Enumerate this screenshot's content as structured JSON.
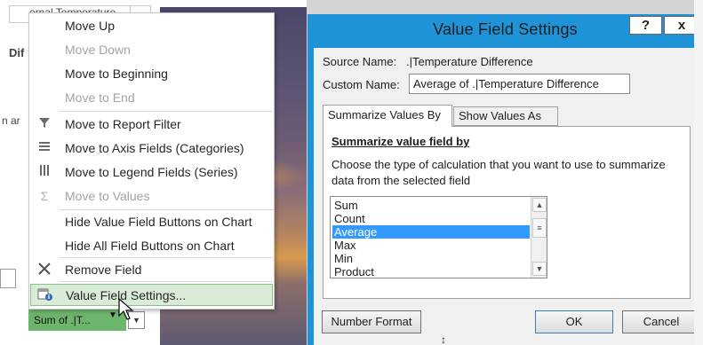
{
  "background": {
    "top_field_text": "ernal Temperature",
    "dif_text": "Dif",
    "n_ar_text": "n ar",
    "field_button_label": "Sum of .|T...",
    "field_button_color": "#6db56d"
  },
  "context_menu": {
    "items": [
      {
        "label": "Move Up",
        "icon": "",
        "disabled": false
      },
      {
        "label": "Move Down",
        "icon": "",
        "disabled": true
      },
      {
        "label": "Move to Beginning",
        "icon": "",
        "disabled": false
      },
      {
        "label": "Move to End",
        "icon": "",
        "disabled": true
      },
      {
        "label": "Move to Report Filter",
        "icon": "filter-icon",
        "disabled": false
      },
      {
        "label": "Move to Axis Fields (Categories)",
        "icon": "rows-icon",
        "disabled": false
      },
      {
        "label": "Move to Legend Fields (Series)",
        "icon": "columns-icon",
        "disabled": false
      },
      {
        "label": "Move to Values",
        "icon": "sigma-icon",
        "disabled": true
      },
      {
        "label": "Hide Value Field Buttons on Chart",
        "icon": "",
        "disabled": false
      },
      {
        "label": "Hide All Field Buttons on Chart",
        "icon": "",
        "disabled": false
      },
      {
        "label": "Remove Field",
        "icon": "close-x-icon",
        "disabled": false
      },
      {
        "label": "Value Field Settings...",
        "icon": "field-settings-icon",
        "disabled": false,
        "highlighted": true
      }
    ],
    "highlight_color": "#d8ecd8"
  },
  "dialog": {
    "title": "Value Field Settings",
    "help_label": "?",
    "close_label": "x",
    "title_bar_color": "#1e93d7",
    "source_name_label": "Source Name:",
    "source_name_value": ".|Temperature Difference",
    "custom_name_label": "Custom Name:",
    "custom_name_value": "Average of .|Temperature Difference",
    "tabs": [
      {
        "label": "Summarize Values By",
        "active": true
      },
      {
        "label": "Show Values As",
        "active": false
      }
    ],
    "panel_heading": "Summarize value field by",
    "panel_description": "Choose the type of calculation that you want to use to summarize data from the selected field",
    "calculations": [
      "Sum",
      "Count",
      "Average",
      "Max",
      "Min",
      "Product"
    ],
    "selected_calculation": "Average",
    "selection_color": "#3399ff",
    "number_format_label": "Number Format",
    "ok_label": "OK",
    "cancel_label": "Cancel"
  }
}
